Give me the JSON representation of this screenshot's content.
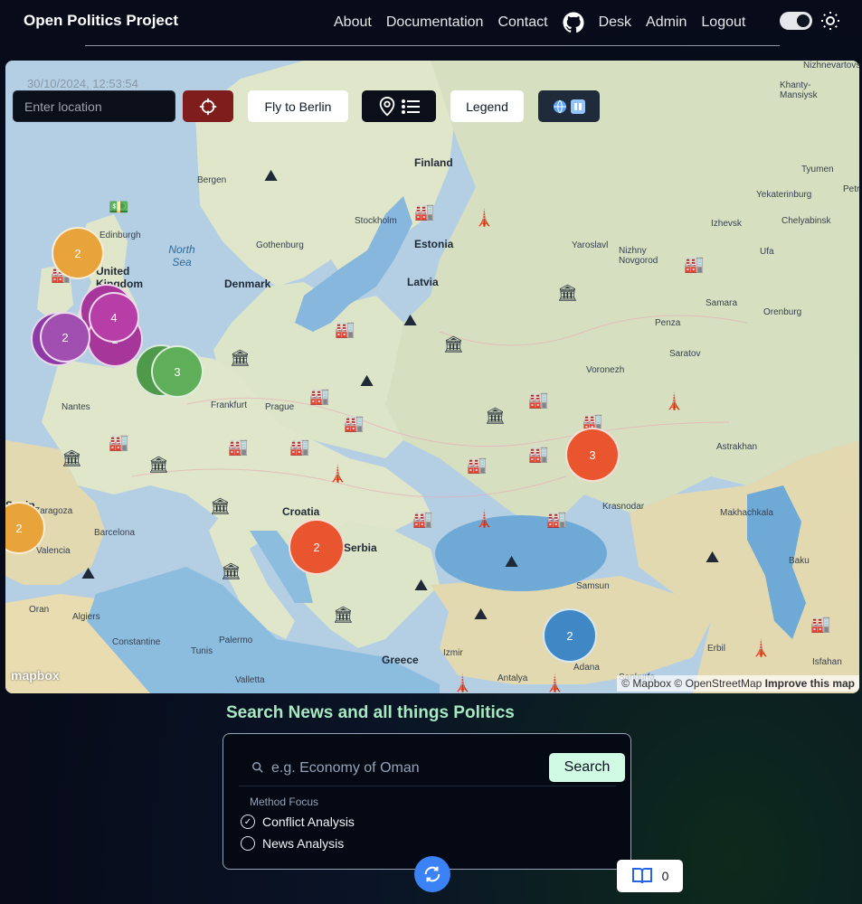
{
  "nav": {
    "brand": "Open Politics Project",
    "links": [
      "About",
      "Documentation",
      "Contact"
    ],
    "links2": [
      "Desk",
      "Admin",
      "Logout"
    ]
  },
  "map": {
    "timestamp": "30/10/2024, 12:53:54",
    "location_placeholder": "Enter location",
    "fly_label": "Fly to Berlin",
    "legend_label": "Legend",
    "attribution": "© Mapbox © OpenStreetMap",
    "improve": "Improve this map",
    "logo": "mapbox",
    "labels": {
      "finland": "Finland",
      "estonia": "Estonia",
      "latvia": "Latvia",
      "denmark": "Denmark",
      "uk": "United Kingdom",
      "north_sea": "North Sea",
      "bergen": "Bergen",
      "stockholm": "Stockholm",
      "gothenburg": "Gothenburg",
      "edinburgh": "Edinburgh",
      "frankfurt": "Frankfurt",
      "prague": "Prague",
      "nantes": "Nantes",
      "croatia": "Croatia",
      "serbia": "Serbia",
      "zaragoza": "Zaragoza",
      "barcelona": "Barcelona",
      "valencia": "Valencia",
      "spain": "Spain",
      "oran": "Oran",
      "algiers": "Algiers",
      "constantine": "Constantine",
      "tunis": "Tunis",
      "palermo": "Palermo",
      "valletta": "Valletta",
      "greece": "Greece",
      "izmir": "Izmir",
      "antalya": "Antalya",
      "adana": "Adana",
      "sanliurfa": "Şanlıurfa",
      "erbil": "Erbil",
      "isfahan": "Isfahan",
      "samsun": "Samsun",
      "krasnodar": "Krasnodar",
      "makhachkala": "Makhachkala",
      "baku": "Baku",
      "astrakhan": "Astrakhan",
      "voronezh": "Voronezh",
      "saratov": "Saratov",
      "penza": "Penza",
      "samara": "Samara",
      "orenburg": "Orenburg",
      "ufa": "Ufa",
      "izhevsk": "Izhevsk",
      "chelyabinsk": "Chelyabinsk",
      "yekaterinburg": "Yekaterinburg",
      "tyumen": "Tyumen",
      "yaroslavl": "Yaroslavl",
      "nizhny": "Nizhny Novgorod",
      "nizhnevartovsk": "Nizhnevartovsk",
      "khanty": "Khanty-Mansiysk",
      "petr": "Petr"
    }
  },
  "clusters": [
    "2",
    "4",
    "2",
    "4",
    "2",
    "2",
    "2",
    "3",
    "3",
    "2",
    "2",
    "2"
  ],
  "search": {
    "title": "Search News and all things Politics",
    "placeholder": "e.g. Economy of Oman",
    "button": "Search",
    "method_label": "Method Focus",
    "options": [
      "Conflict Analysis",
      "News Analysis"
    ]
  },
  "bookmarks": {
    "count": "0"
  },
  "colors": {
    "accent": "#a7e9c1",
    "refresh": "#3b82f6",
    "locate": "#7f1d1d"
  }
}
